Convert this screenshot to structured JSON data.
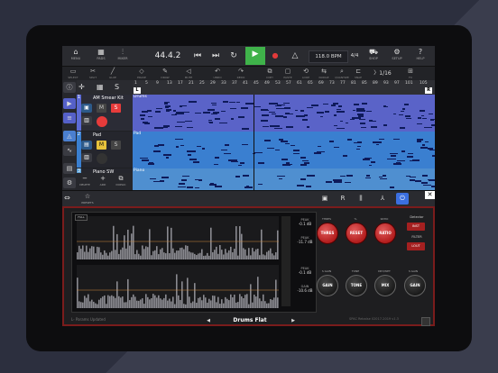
{
  "toolbar": {
    "items": [
      {
        "label": "MENU",
        "icon": "home-icon"
      },
      {
        "label": "PADS",
        "icon": "pads-icon"
      },
      {
        "label": "MIXER",
        "icon": "mixer-icon"
      }
    ],
    "position": "44.4.2",
    "tempo": "118.0 BPM",
    "time_signature": "4/4",
    "right_items": [
      {
        "label": "SHOP",
        "icon": "cart-icon"
      },
      {
        "label": "SETUP",
        "icon": "gear-icon"
      },
      {
        "label": "HELP",
        "icon": "question-icon"
      }
    ]
  },
  "toolbar2": {
    "items": [
      {
        "label": "SELECT",
        "icon": "select-icon"
      },
      {
        "label": "SPLIT",
        "icon": "scissors-icon"
      },
      {
        "label": "GLUE",
        "icon": "glue-icon"
      },
      {
        "label": "ERASE",
        "icon": "eraser-icon"
      },
      {
        "label": "DRAW",
        "icon": "pencil-icon"
      },
      {
        "label": "MUTE",
        "icon": "speaker-icon"
      },
      {
        "label": "UNDO",
        "icon": "undo-icon"
      },
      {
        "label": "REDO",
        "icon": "redo-icon"
      },
      {
        "label": "COPY",
        "icon": "copy-icon"
      },
      {
        "label": "PASTE",
        "icon": "paste-icon"
      },
      {
        "label": "LOOP",
        "icon": "loop-icon"
      },
      {
        "label": "NUDGE",
        "icon": "nudge-icon"
      },
      {
        "label": "QUANTIZE",
        "icon": "quantize-icon"
      },
      {
        "label": "SNAP",
        "icon": "snap-icon"
      },
      {
        "label": "FX",
        "icon": "fx-icon"
      }
    ],
    "quantize": "1/16"
  },
  "ruler": {
    "ticks": [
      "1",
      "5",
      "9",
      "13",
      "17",
      "21",
      "25",
      "29",
      "33",
      "37",
      "41",
      "45",
      "49",
      "53",
      "57",
      "61",
      "65",
      "69",
      "73",
      "77",
      "81",
      "85",
      "89",
      "93",
      "97",
      "101",
      "105"
    ],
    "left_marker": "L",
    "right_marker": "R"
  },
  "tracks": [
    {
      "num": "1",
      "name": "AM Smear Kit",
      "clip": "Drums",
      "color": "#5c6bd4"
    },
    {
      "num": "2",
      "name": "Pad",
      "clip": "Pad",
      "color": "#3a7fd0"
    },
    {
      "num": "3",
      "name": "Piano SW",
      "clip": "Piano",
      "color": "#5c9fd4"
    }
  ],
  "edit_tools": [
    {
      "label": "DELETE",
      "icon": "minus-icon"
    },
    {
      "label": "ADD",
      "icon": "plus-icon"
    },
    {
      "label": "DUPLIC",
      "icon": "duplicate-icon"
    }
  ],
  "panel": {
    "presets_label": "PRESETS",
    "tabs": [
      "fx-icon",
      "r-icon",
      "mixer-icon",
      "fork-icon",
      "power-icon"
    ]
  },
  "plugin": {
    "full_label": "FULL",
    "peak_top": {
      "label": "PEAK",
      "value": "-0.1 dB"
    },
    "peak2_top": {
      "label": "PEAK",
      "value": "-11.7 dB"
    },
    "peak_bottom": {
      "label": "PEAK",
      "value": "-0.1 dB"
    },
    "gain_bottom": {
      "label": "GAIN",
      "value": "-10.6 dB"
    },
    "knobs": [
      {
        "label": "THRES",
        "caption": "THRES"
      },
      {
        "label": "RESET",
        "caption": "%"
      },
      {
        "label": "RATIO",
        "caption": "RATIO"
      },
      {
        "label": "GAIN",
        "caption": "S GAIN"
      },
      {
        "label": "TONE",
        "caption": "TONE"
      },
      {
        "label": "MIX",
        "caption": "DRY/WET"
      },
      {
        "label": "GAIN",
        "caption": "S GAIN"
      }
    ],
    "side": {
      "detector": "Detector",
      "inst_btn": "INST",
      "filter": "FILTER",
      "lout_btn": "LOUT"
    },
    "preset_name": "Drums Flat",
    "status": "L- Params Updated",
    "version": "SPAC Rebalse 02017-2019 v1.3"
  }
}
